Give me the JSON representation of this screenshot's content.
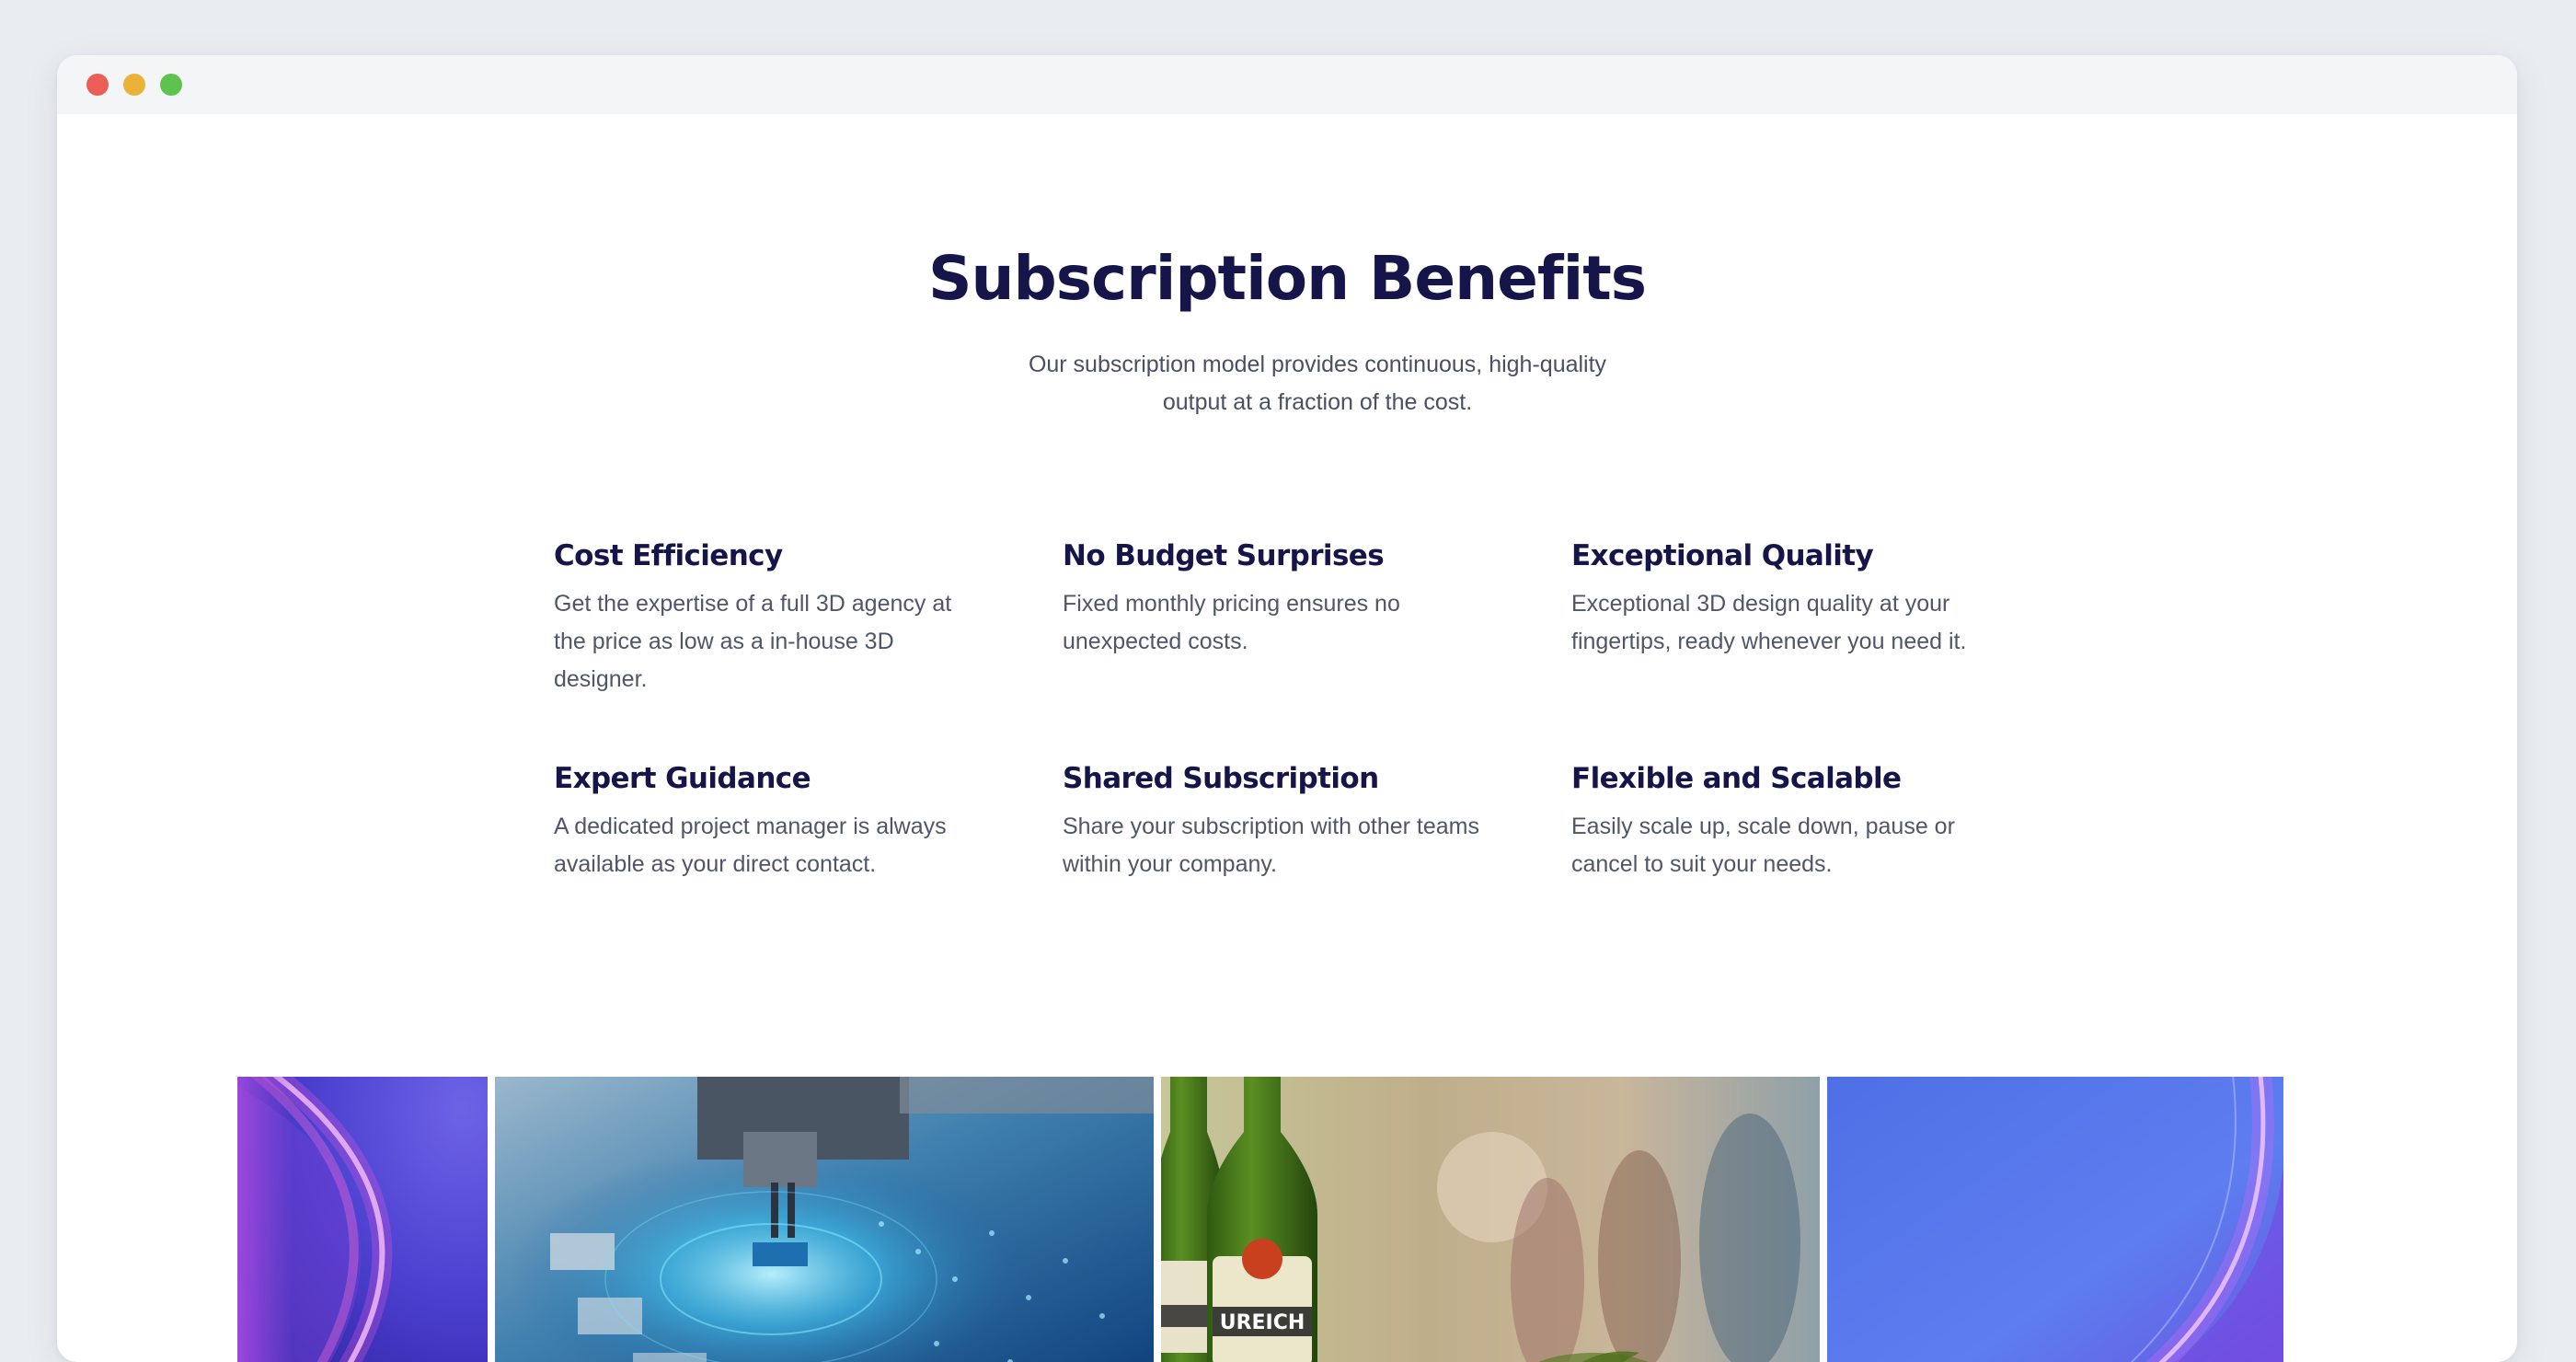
{
  "window": {
    "controls": [
      "close",
      "minimize",
      "maximize"
    ]
  },
  "section": {
    "title": "Subscription Benefits",
    "subtitle": "Our subscription model provides continuous, high-quality output at a fraction of the cost."
  },
  "features": [
    {
      "title": "Cost Efficiency",
      "description": "Get the expertise of a full 3D agency at the price as low as a in-house 3D designer."
    },
    {
      "title": "No Budget Surprises",
      "description": "Fixed monthly pricing ensures no unexpected costs."
    },
    {
      "title": "Exceptional Quality",
      "description": "Exceptional 3D design quality at your fingertips, ready whenever you need it."
    },
    {
      "title": "Expert Guidance",
      "description": "A dedicated project manager is always available as your direct contact."
    },
    {
      "title": "Shared Subscription",
      "description": "Share your subscription with other teams within your company."
    },
    {
      "title": "Flexible and Scalable",
      "description": "Easily scale up, scale down, pause or cancel to suit your needs."
    }
  ],
  "gallery": {
    "images": [
      "abstract-purple-wave",
      "circuit-board-robot-arm",
      "green-beer-bottles",
      "abstract-blue-wave"
    ],
    "bottle_label": "UREICH"
  },
  "colors": {
    "heading": "#161549",
    "body_text": "#50566a",
    "background": "#e9edf1"
  }
}
